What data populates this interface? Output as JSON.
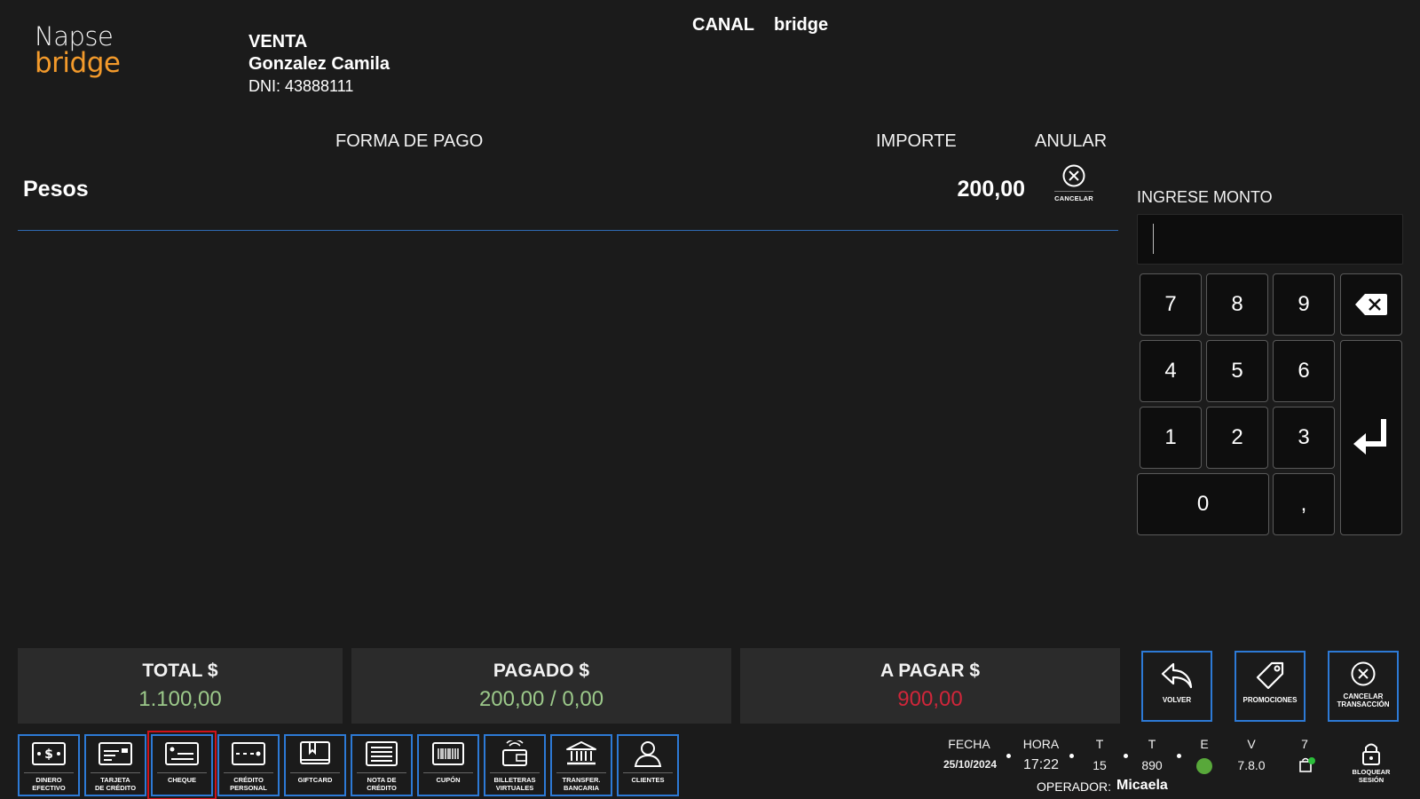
{
  "logo": {
    "line1": "Napse",
    "line2": "bridge"
  },
  "header": {
    "sale_type": "VENTA",
    "customer_name": "Gonzalez Camila",
    "customer_dni": "DNI: 43888111",
    "canal_label": "CANAL",
    "canal_value": "bridge"
  },
  "payments": {
    "col_forma": "FORMA DE PAGO",
    "col_importe": "IMPORTE",
    "col_anular": "ANULAR",
    "rows": [
      {
        "method": "Pesos",
        "amount": "200,00",
        "cancel_label": "CANCELAR"
      }
    ]
  },
  "amount_entry": {
    "label": "INGRESE MONTO",
    "value": ""
  },
  "keypad": {
    "k7": "7",
    "k8": "8",
    "k9": "9",
    "k4": "4",
    "k5": "5",
    "k6": "6",
    "k1": "1",
    "k2": "2",
    "k3": "3",
    "k0": "0",
    "kcomma": ","
  },
  "totals": {
    "total_label": "TOTAL $",
    "total_value": "1.100,00",
    "pagado_label": "PAGADO $",
    "pagado_value": "200,00 / 0,00",
    "apagar_label": "A PAGAR $",
    "apagar_value": "900,00"
  },
  "actions": {
    "volver": "VOLVER",
    "promociones": "PROMOCIONES",
    "cancelar_l1": "CANCELAR",
    "cancelar_l2": "TRANSACCIÓN"
  },
  "toolbar": {
    "dinero_l1": "DINERO",
    "dinero_l2": "EFECTIVO",
    "tarjeta_l1": "TARJETA",
    "tarjeta_l2": "DE CRÉDITO",
    "cheque": "CHEQUE",
    "credito_l1": "CRÉDITO",
    "credito_l2": "PERSONAL",
    "giftcard": "GIFTCARD",
    "nota_l1": "NOTA DE",
    "nota_l2": "CRÉDITO",
    "cupon": "CUPÓN",
    "billeteras_l1": "BILLETERAS",
    "billeteras_l2": "VIRTUALES",
    "transfer_l1": "TRANSFER.",
    "transfer_l2": "BANCARIA",
    "clientes": "CLIENTES",
    "selected": "cheque"
  },
  "status": {
    "fecha_label": "FECHA",
    "fecha_value": "25/10/2024",
    "hora_label": "HORA",
    "hora_value": "17:22",
    "t1_label": "T",
    "t1_value": "15",
    "t2_label": "T",
    "t2_value": "890",
    "e_label": "E",
    "e_status_color": "#58a83a",
    "v_label": "V",
    "v_value": "7.8.0",
    "n_label": "7",
    "operator_label": "OPERADOR:",
    "operator_value": "Micaela",
    "lock_l1": "BLOQUEAR",
    "lock_l2": "SESIÓN"
  },
  "colors": {
    "accent": "#2d7ad6",
    "total": "#9cc98a",
    "due": "#d0263a",
    "selected": "#d0121b",
    "brand": "#f39a2b"
  }
}
